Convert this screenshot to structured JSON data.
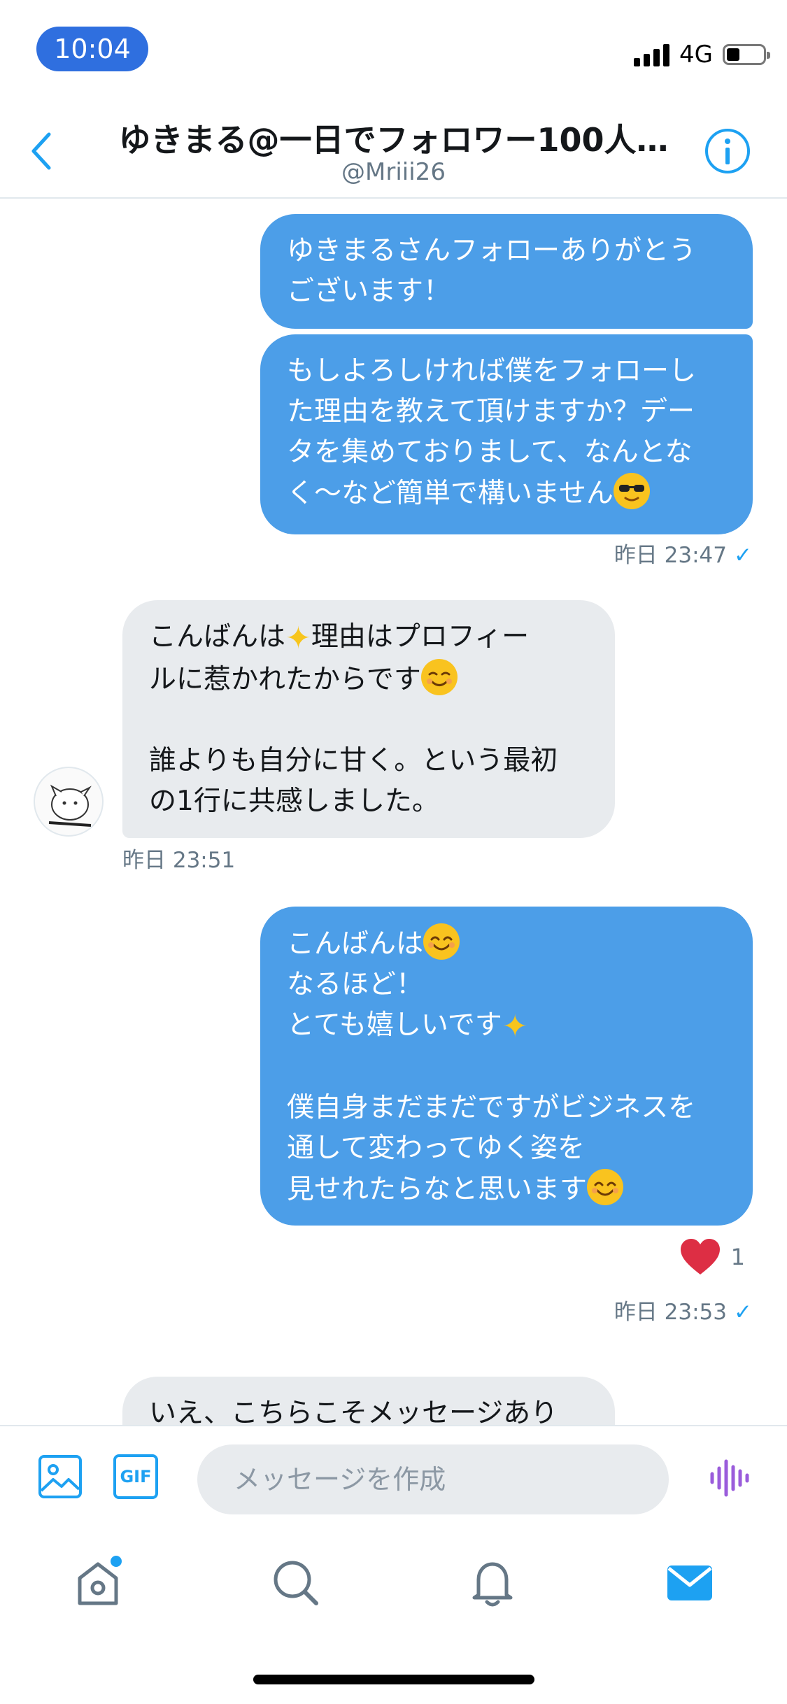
{
  "status_bar": {
    "time": "10:04",
    "network": "4G",
    "battery_level": 0.3
  },
  "header": {
    "title": "ゆきまる@一日でフォロワー100人…",
    "handle": "@Mriii26"
  },
  "messages": [
    {
      "from": "me",
      "lines": [
        "ゆきまるさんフォローありがとう",
        "ございます！"
      ]
    },
    {
      "from": "me",
      "lines": [
        "もしよろしければ僕をフォローし",
        "た理由を教えて頂けますか？デー",
        "タを集めておりまして、なんとな",
        "く〜など簡単で構いません"
      ],
      "emoji": "smiling-face-with-sunglasses",
      "time": "昨日 23:47"
    },
    {
      "from": "them",
      "lines": [
        "こんばんは",
        "理由はプロフィー",
        "ルに惹かれたからです",
        "",
        "誰よりも自分に甘く。という最初",
        "の1行に共感しました。"
      ],
      "emoji": [
        "sparkles",
        "smiling-face"
      ],
      "time": "昨日 23:51"
    },
    {
      "from": "me",
      "lines": [
        "こんばんは",
        "なるほど！",
        "とても嬉しいです",
        "",
        "僕自身まだまだですがビジネスを",
        "通して変わってゆく姿を",
        "見せれたらなと思います"
      ],
      "emoji": [
        "smiling-face-with-smiling-eyes",
        "sparkles",
        "smiling-face-with-smiling-eyes"
      ],
      "time": "昨日 23:53",
      "reaction": {
        "icon": "heart",
        "count": "1"
      }
    },
    {
      "from": "them",
      "lines": [
        "いえ、こちらこそメッセージあり"
      ]
    }
  ],
  "composer": {
    "placeholder": "メッセージを作成",
    "gif_label": "GIF"
  },
  "tabs": [
    "home",
    "search",
    "notifications",
    "messages"
  ],
  "colors": {
    "sent_bubble": "#4c9ee8",
    "received_bubble": "#e8ebee",
    "accent": "#1da1f2",
    "heart": "#e0245e",
    "voice": "#9a5cdb"
  }
}
